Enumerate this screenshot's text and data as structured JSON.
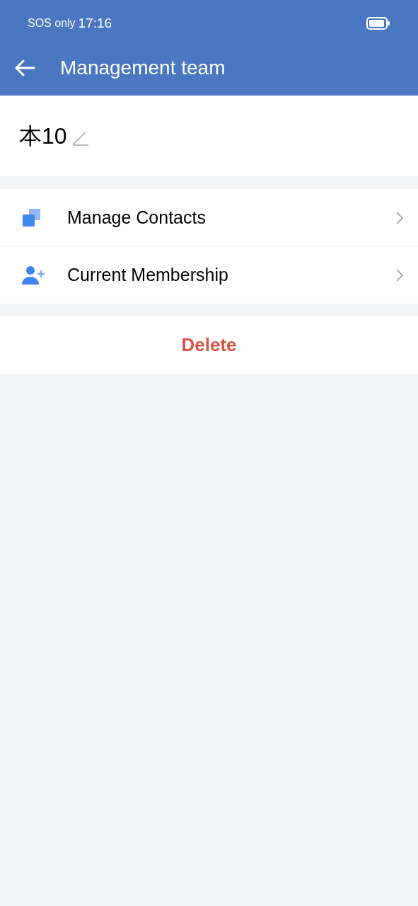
{
  "status_bar": {
    "carrier": "SOS only",
    "time": "17:16"
  },
  "header": {
    "title": "Management team"
  },
  "team": {
    "name": "本10"
  },
  "menu": [
    {
      "kind": "contacts",
      "label": "Manage Contacts"
    },
    {
      "kind": "member",
      "label": "Current Membership"
    }
  ],
  "delete_button": "Delete"
}
